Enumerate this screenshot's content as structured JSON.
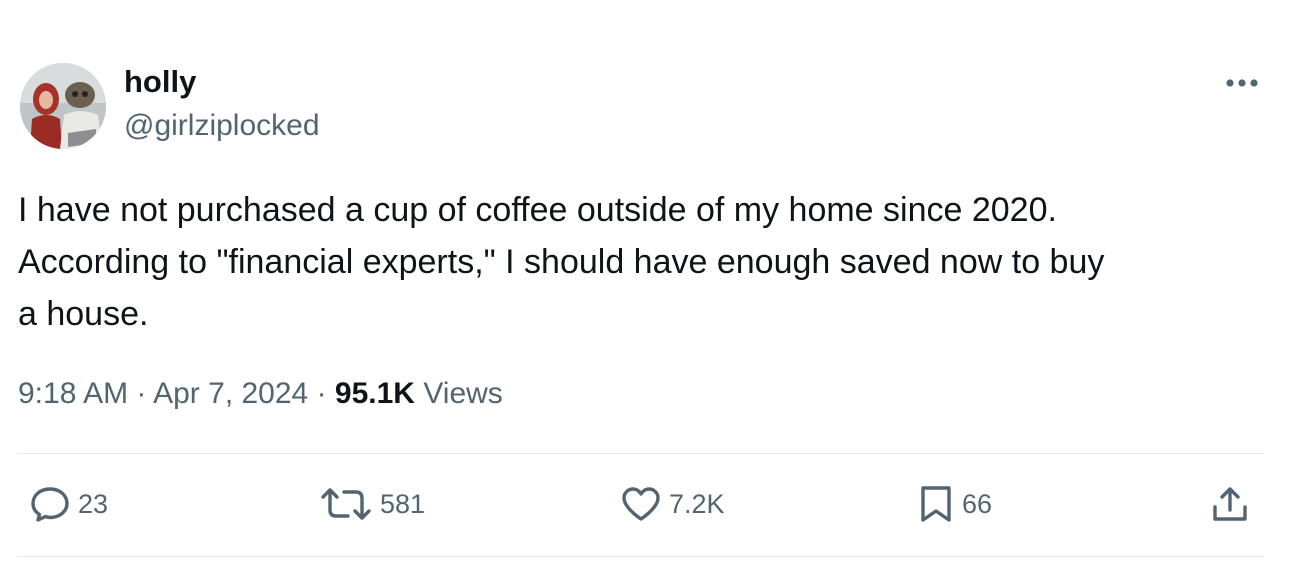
{
  "author": {
    "name": "holly",
    "handle": "@girlziplocked"
  },
  "tweet": {
    "text": "I have not purchased a cup of coffee outside of my home since 2020.\nAccording to \"financial experts,\" I should have enough saved now to buy\na house."
  },
  "meta": {
    "time": "9:18 AM",
    "separator": "·",
    "date": "Apr 7, 2024",
    "views_count": "95.1K",
    "views_label": "Views"
  },
  "actions": {
    "replies": "23",
    "reposts": "581",
    "likes": "7.2K",
    "bookmarks": "66"
  },
  "icons": {
    "more": "more-horizontal-icon",
    "reply": "reply-icon",
    "repost": "repost-icon",
    "like": "heart-icon",
    "bookmark": "bookmark-icon",
    "share": "share-icon"
  },
  "colors": {
    "text_primary": "#0f1419",
    "text_secondary": "#536471",
    "divider": "#e6e9eb"
  }
}
